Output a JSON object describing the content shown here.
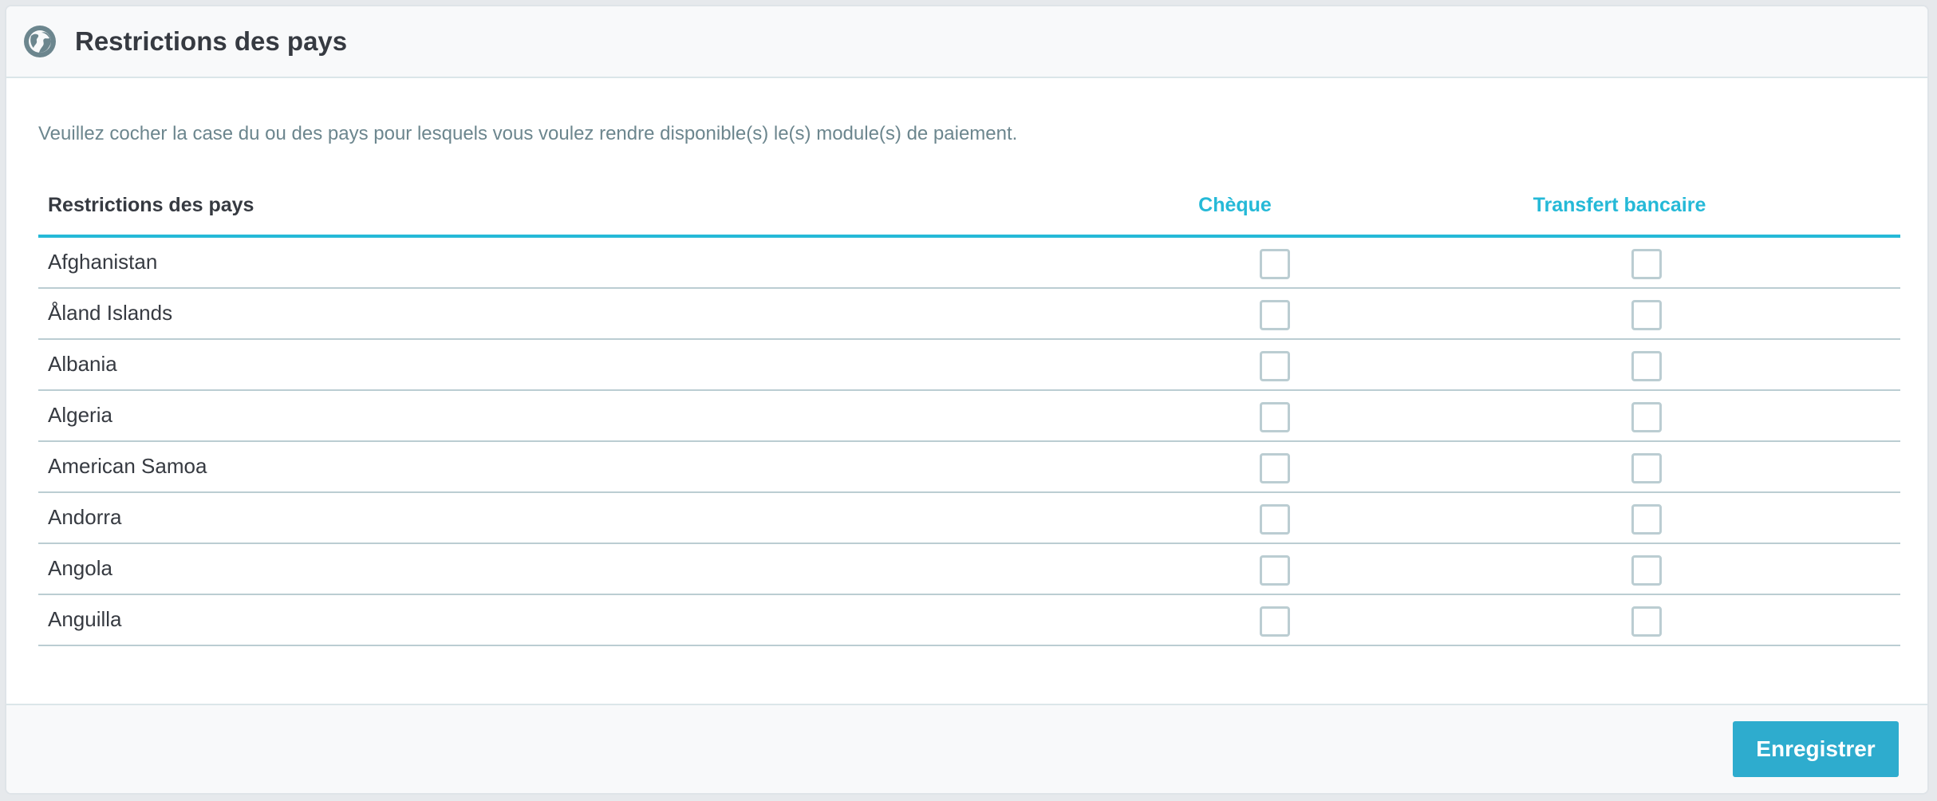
{
  "panel": {
    "title": "Restrictions des pays",
    "icon": "globe-icon",
    "help_text": "Veuillez cocher la case du ou des pays pour lesquels vous voulez rendre disponible(s) le(s) module(s) de paiement."
  },
  "table": {
    "headers": {
      "country": "Restrictions des pays",
      "col1": "Chèque",
      "col2": "Transfert bancaire"
    },
    "rows": [
      {
        "name": "Afghanistan",
        "cheque": false,
        "transfert": false
      },
      {
        "name": "Åland Islands",
        "cheque": false,
        "transfert": false
      },
      {
        "name": "Albania",
        "cheque": false,
        "transfert": false
      },
      {
        "name": "Algeria",
        "cheque": false,
        "transfert": false
      },
      {
        "name": "American Samoa",
        "cheque": false,
        "transfert": false
      },
      {
        "name": "Andorra",
        "cheque": false,
        "transfert": false
      },
      {
        "name": "Angola",
        "cheque": false,
        "transfert": false
      },
      {
        "name": "Anguilla",
        "cheque": false,
        "transfert": false
      }
    ]
  },
  "footer": {
    "save_label": "Enregistrer"
  },
  "colors": {
    "accent": "#25b9d7",
    "button": "#2eacce",
    "text": "#363a41",
    "muted": "#6c868e",
    "checkbox_border": "#bbcdd2"
  }
}
